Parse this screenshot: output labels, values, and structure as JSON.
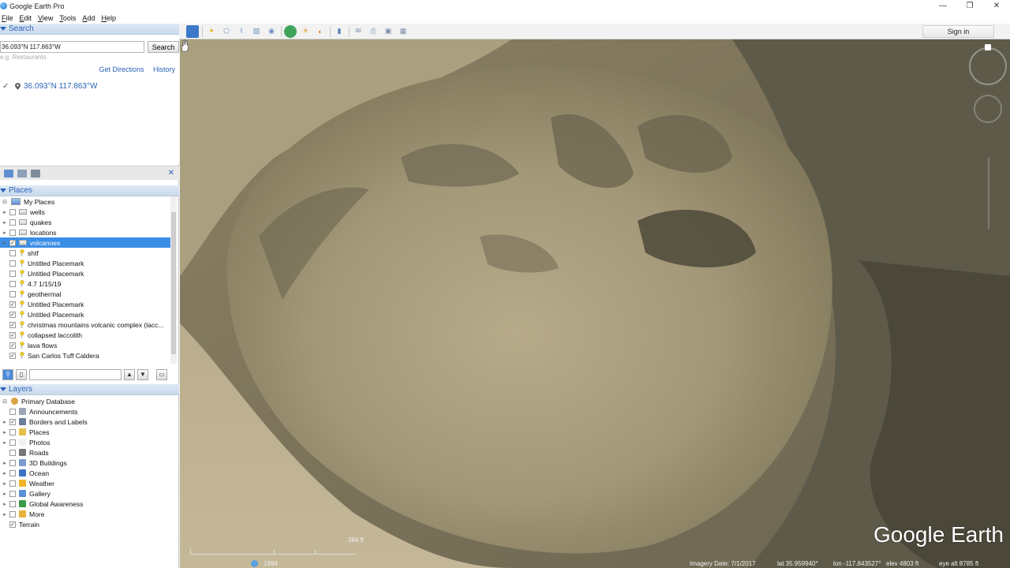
{
  "window": {
    "title": "Google Earth Pro",
    "controls": [
      "—",
      "❐",
      "✕"
    ]
  },
  "menu": [
    "File",
    "Edit",
    "View",
    "Tools",
    "Add",
    "Help"
  ],
  "search": {
    "header": "Search",
    "value": "36.093°N 117.863°W",
    "button": "Search",
    "hint": "e.g. Restaurants",
    "get_directions": "Get Directions",
    "history": "History",
    "result": "36.093°N 117.863°W"
  },
  "places": {
    "header": "Places",
    "items": [
      {
        "label": "My Places",
        "level": 0,
        "type": "root",
        "checked": false,
        "expander": "⊟"
      },
      {
        "label": "wells",
        "level": 1,
        "type": "folder",
        "checked": false,
        "expander": "▸"
      },
      {
        "label": "quakes",
        "level": 1,
        "type": "folder",
        "checked": false,
        "expander": "▸"
      },
      {
        "label": "locations",
        "level": 1,
        "type": "folder",
        "checked": false,
        "expander": "▸"
      },
      {
        "label": "volcanoes",
        "level": 1,
        "type": "folder",
        "checked": true,
        "expander": "▸",
        "selected": true
      },
      {
        "label": "shtf",
        "level": 1,
        "type": "pin",
        "checked": false,
        "expander": ""
      },
      {
        "label": "Untitled Placemark",
        "level": 1,
        "type": "pin",
        "checked": false,
        "expander": ""
      },
      {
        "label": "Untitled Placemark",
        "level": 1,
        "type": "pin",
        "checked": false,
        "expander": ""
      },
      {
        "label": "4.7 1/15/19",
        "level": 1,
        "type": "pin",
        "checked": false,
        "expander": ""
      },
      {
        "label": "geothermal",
        "level": 1,
        "type": "pin",
        "checked": false,
        "expander": ""
      },
      {
        "label": "Untitled Placemark",
        "level": 1,
        "type": "pin",
        "checked": true,
        "expander": ""
      },
      {
        "label": "Untitled Placemark",
        "level": 1,
        "type": "pin",
        "checked": true,
        "expander": ""
      },
      {
        "label": "christmas mountains volcanic complex (lacc...",
        "level": 1,
        "type": "pin",
        "checked": true,
        "expander": ""
      },
      {
        "label": "collapsed laccolith",
        "level": 1,
        "type": "pin",
        "checked": true,
        "expander": ""
      },
      {
        "label": "lava flows",
        "level": 1,
        "type": "pin",
        "checked": true,
        "expander": ""
      },
      {
        "label": "San Carlos Tuff Caldera",
        "level": 1,
        "type": "pin",
        "checked": true,
        "expander": ""
      }
    ]
  },
  "layers": {
    "header": "Layers",
    "items": [
      {
        "label": "Primary Database",
        "level": 0,
        "checked": false,
        "expander": "⊟",
        "icon": "globe-icon",
        "color": "#d9a441"
      },
      {
        "label": "Announcements",
        "level": 1,
        "checked": false,
        "expander": "",
        "icon": "announcement-icon",
        "color": "#9aa6b5"
      },
      {
        "label": "Borders and Labels",
        "level": 1,
        "checked": true,
        "expander": "▸",
        "icon": "borders-icon",
        "color": "#6d7f99"
      },
      {
        "label": "Places",
        "level": 1,
        "checked": false,
        "expander": "▸",
        "icon": "places-icon",
        "color": "#e6c04a"
      },
      {
        "label": "Photos",
        "level": 1,
        "checked": false,
        "expander": "▸",
        "icon": "photos-icon",
        "color": "#f1f1f1"
      },
      {
        "label": "Roads",
        "level": 1,
        "checked": false,
        "expander": "",
        "icon": "roads-icon",
        "color": "#777777"
      },
      {
        "label": "3D Buildings",
        "level": 1,
        "checked": false,
        "expander": "▸",
        "icon": "buildings-icon",
        "color": "#7a9ccf"
      },
      {
        "label": "Ocean",
        "level": 1,
        "checked": false,
        "expander": "▸",
        "icon": "ocean-icon",
        "color": "#3b73c4"
      },
      {
        "label": "Weather",
        "level": 1,
        "checked": false,
        "expander": "▸",
        "icon": "weather-icon",
        "color": "#f1b52a"
      },
      {
        "label": "Gallery",
        "level": 1,
        "checked": false,
        "expander": "▸",
        "icon": "gallery-icon",
        "color": "#5c8fd6"
      },
      {
        "label": "Global Awareness",
        "level": 1,
        "checked": false,
        "expander": "▸",
        "icon": "awareness-icon",
        "color": "#3a9a4a"
      },
      {
        "label": "More",
        "level": 1,
        "checked": false,
        "expander": "▸",
        "icon": "more-icon",
        "color": "#e8b23a"
      },
      {
        "label": "Terrain",
        "level": 0,
        "checked": true,
        "expander": "",
        "icon": "",
        "color": ""
      }
    ]
  },
  "toolbar": {
    "sign_in": "Sign in"
  },
  "map": {
    "brand": "Google Earth",
    "scale_label": "384 ft",
    "year": "1994",
    "imagery_date": "Imagery Date: 7/1/2017",
    "lat": "lat  35.959940°",
    "lon": "lon -117.843527°",
    "elev": "elev  4803 ft",
    "eye_alt": "eye alt   8785 ft"
  },
  "colors": {
    "accent": "#2a63b8",
    "selection": "#3a8ee6"
  }
}
